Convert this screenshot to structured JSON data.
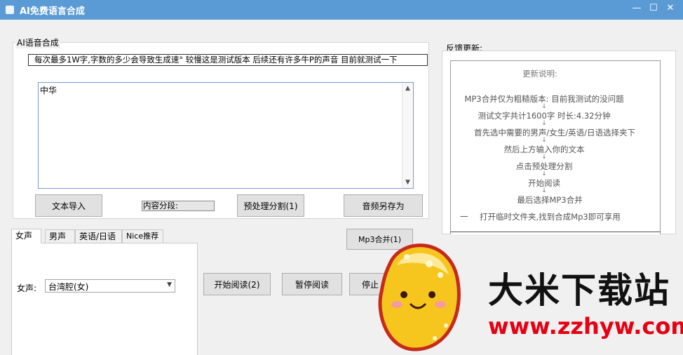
{
  "window": {
    "title": "AI免费语言合成",
    "minimize": "—",
    "maximize": "☐",
    "close": "✕"
  },
  "tts_group": {
    "title": "AI语音合成",
    "notice": "每次最多1W字,字数的多少会导致生成速°   较慢这是测试版本     后续还有许多牛P的声音 目前就测试一下",
    "input_text": "中华",
    "scroll_up": "▲",
    "scroll_down": "▼",
    "import_button": "文本导入",
    "segments_label": "内容分段:",
    "segments_value": "",
    "preprocess_button": "预处理分割(1)",
    "save_audio_button": "音频另存为"
  },
  "voice_tabs": {
    "tabs": [
      "女声",
      "男声",
      "英语/日语",
      "Nice推荐"
    ],
    "active": "女声",
    "voice_label": "女声:",
    "voice_selected": "台湾腔(女)",
    "dropdown_arrow": "▼"
  },
  "controls": {
    "merge_mp3": "Mp3合并(1)",
    "start_read": "开始阅读(2)",
    "pause_read": "暂停阅读",
    "stop_read": "停止"
  },
  "feedback": {
    "title": "反馈更新:",
    "heading": "更新说明:",
    "lines": [
      "MP3合并仅为粗糙版本: 目前我测试的没问题",
      "测试文字共计1600字 时长:4.32分钟",
      "首先选中需要的男声/女生/英语/日语选择夹下",
      "然后上方输入你的文本",
      "点击预处理分割",
      "开始阅读",
      "最后选择MP3合并",
      "打开临时文件夹,找到合成Mp3即可享用"
    ],
    "bullet": "一",
    "flow_arrow": "↓"
  },
  "watermark": {
    "site_name": "大米下载站",
    "site_url": "www.zzhyw.com"
  },
  "colors": {
    "titlebar": "#5b9bd5",
    "accent_border": "#7a9cd3",
    "watermark_red": "#e60012",
    "watermark_blue": "#1565c0"
  }
}
